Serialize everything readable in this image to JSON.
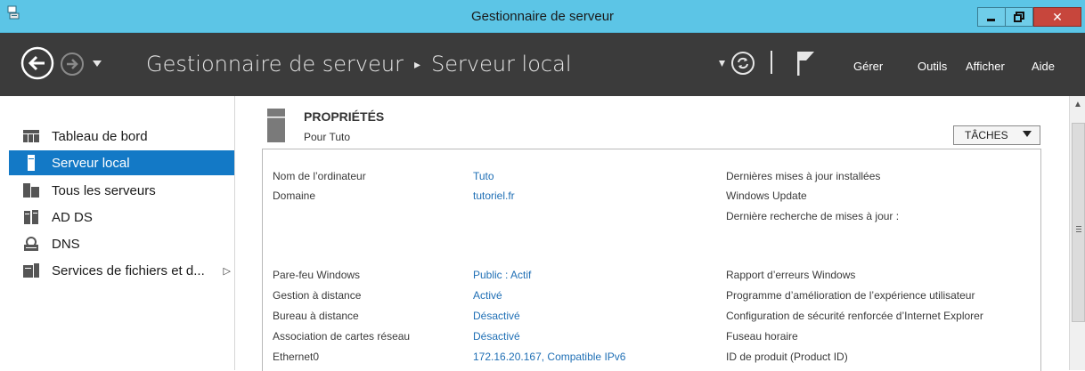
{
  "window": {
    "title": "Gestionnaire de serveur"
  },
  "header": {
    "breadcrumb_root": "Gestionnaire de serveur",
    "breadcrumb_separator": "▸",
    "breadcrumb_current": "Serveur local",
    "menu": {
      "manage": "Gérer",
      "tools": "Outils",
      "view": "Afficher",
      "help": "Aide"
    }
  },
  "sidebar": {
    "items": [
      {
        "label": "Tableau de bord",
        "icon": "dashboard-icon"
      },
      {
        "label": "Serveur local",
        "icon": "server-icon",
        "active": true
      },
      {
        "label": "Tous les serveurs",
        "icon": "servers-icon"
      },
      {
        "label": "AD DS",
        "icon": "ad-ds-icon"
      },
      {
        "label": "DNS",
        "icon": "dns-icon"
      },
      {
        "label": "Services de fichiers et d...",
        "icon": "file-services-icon",
        "has_submenu": true
      }
    ]
  },
  "properties": {
    "title": "PROPRIÉTÉS",
    "subtitle": "Pour Tuto",
    "tasks_label": "TÂCHES",
    "left_rows": [
      {
        "label": "Nom de l’ordinateur",
        "value": "Tuto"
      },
      {
        "label": "Domaine",
        "value": "tutoriel.fr"
      },
      {
        "label": "Pare-feu Windows",
        "value": "Public : Actif"
      },
      {
        "label": "Gestion à distance",
        "value": "Activé"
      },
      {
        "label": "Bureau à distance",
        "value": "Désactivé"
      },
      {
        "label": "Association de cartes réseau",
        "value": "Désactivé"
      },
      {
        "label": "Ethernet0",
        "value": "172.16.20.167, Compatible IPv6"
      }
    ],
    "right_rows": [
      "Dernières mises à jour installées",
      "Windows Update",
      "Dernière recherche de mises à jour :",
      "Rapport d’erreurs Windows",
      "Programme d’amélioration de l’expérience utilisateur",
      "Configuration de sécurité renforcée d’Internet Explorer",
      "Fuseau horaire",
      "ID de produit (Product ID)"
    ]
  },
  "colors": {
    "titlebar": "#5cc5e6",
    "header": "#3b3b3b",
    "accent": "#1379c6",
    "link": "#1f6fb5"
  }
}
